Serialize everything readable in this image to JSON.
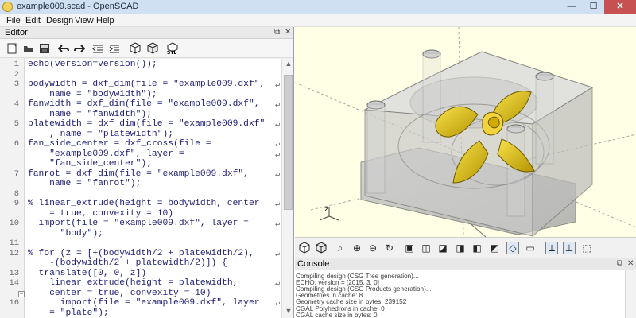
{
  "window": {
    "title": "example009.scad - OpenSCAD",
    "controls": {
      "minimize": "—",
      "maximize": "☐",
      "close": "✕"
    }
  },
  "menu": {
    "items": [
      "File",
      "Edit",
      "Design",
      "View",
      "Help"
    ]
  },
  "editor": {
    "title": "Editor",
    "header_controls": [
      "⧉",
      "✕"
    ],
    "lines": [
      {
        "no": "1",
        "code": "echo(version=version());",
        "wrap": false
      },
      {
        "no": "2",
        "code": "",
        "wrap": false
      },
      {
        "no": "3",
        "code": "bodywidth = dxf_dim(file = \"example009.dxf\",",
        "wrap": true
      },
      {
        "no": "",
        "code": "    name = \"bodywidth\");",
        "wrap": false
      },
      {
        "no": "4",
        "code": "fanwidth = dxf_dim(file = \"example009.dxf\",",
        "wrap": true
      },
      {
        "no": "",
        "code": "    name = \"fanwidth\");",
        "wrap": false
      },
      {
        "no": "5",
        "code": "platewidth = dxf_dim(file = \"example009.dxf\"",
        "wrap": true
      },
      {
        "no": "",
        "code": "    , name = \"platewidth\");",
        "wrap": false
      },
      {
        "no": "6",
        "code": "fan_side_center = dxf_cross(file =",
        "wrap": true
      },
      {
        "no": "",
        "code": "    \"example009.dxf\", layer =",
        "wrap": true
      },
      {
        "no": "",
        "code": "    \"fan_side_center\");",
        "wrap": false
      },
      {
        "no": "7",
        "code": "fanrot = dxf_dim(file = \"example009.dxf\",",
        "wrap": true
      },
      {
        "no": "",
        "code": "    name = \"fanrot\");",
        "wrap": false
      },
      {
        "no": "8",
        "code": "",
        "wrap": false
      },
      {
        "no": "9",
        "code": "% linear_extrude(height = bodywidth, center",
        "wrap": true
      },
      {
        "no": "",
        "code": "    = true, convexity = 10)",
        "wrap": false
      },
      {
        "no": "10",
        "code": "  import(file = \"example009.dxf\", layer =",
        "wrap": true
      },
      {
        "no": "",
        "code": "      \"body\");",
        "wrap": false
      },
      {
        "no": "11",
        "code": "",
        "wrap": false
      },
      {
        "no": "12",
        "code": "% for (z = [+(bodywidth/2 + platewidth/2),",
        "wrap": true
      },
      {
        "no": "",
        "code": "    -(bodywidth/2 + platewidth/2)]) {",
        "wrap": false
      },
      {
        "no": "13",
        "code": "  translate([0, 0, z])",
        "wrap": false
      },
      {
        "no": "14",
        "code": "    linear_extrude(height = platewidth,",
        "wrap": true
      },
      {
        "no": "",
        "code": "    center = true, convexity = 10)",
        "wrap": false
      },
      {
        "no": "16",
        "code": "      import(file = \"example009.dxf\", layer",
        "wrap": true
      },
      {
        "no": "",
        "code": "    = \"plate\");",
        "wrap": false
      }
    ]
  },
  "viewport": {
    "axis_label": "z"
  },
  "console": {
    "title": "Console",
    "header_controls": [
      "⧉",
      "✕"
    ],
    "lines": [
      "Compiling design (CSG Tree generation)...",
      "ECHO: version = [2015, 3, 0]",
      "Compiling design (CSG Products generation)...",
      "Geometries in cache: 8",
      "Geometry cache size in bytes: 239152",
      "CGAL Polyhedrons in cache: 0",
      "CGAL cache size in bytes: 0"
    ]
  },
  "colors": {
    "titlebar": "#cfe0f3",
    "viewport_bg": "#ffffe5",
    "fan_yellow": "#ddc000",
    "body_gray": "#b7b7b7",
    "console_text": "#3c3c3c"
  }
}
